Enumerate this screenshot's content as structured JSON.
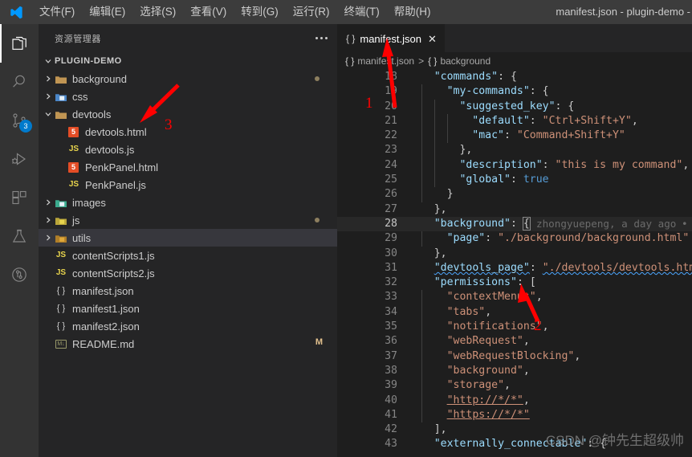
{
  "window": {
    "title": "manifest.json - plugin-demo -",
    "logo_icon": "vscode-logo-icon"
  },
  "menubar": {
    "items": [
      {
        "label": "文件(F)",
        "text": "文件",
        "key": "F"
      },
      {
        "label": "编辑(E)",
        "text": "编辑",
        "key": "E"
      },
      {
        "label": "选择(S)",
        "text": "选择",
        "key": "S"
      },
      {
        "label": "查看(V)",
        "text": "查看",
        "key": "V"
      },
      {
        "label": "转到(G)",
        "text": "转到",
        "key": "G"
      },
      {
        "label": "运行(R)",
        "text": "运行",
        "key": "R"
      },
      {
        "label": "终端(T)",
        "text": "终端",
        "key": "T"
      },
      {
        "label": "帮助(H)",
        "text": "帮助",
        "key": "H"
      }
    ]
  },
  "activitybar": {
    "items": [
      {
        "name": "explorer",
        "icon": "files-icon",
        "active": true,
        "badge": ""
      },
      {
        "name": "search",
        "icon": "search-icon",
        "active": false,
        "badge": ""
      },
      {
        "name": "source-control",
        "icon": "source-control-icon",
        "active": false,
        "badge": "3"
      },
      {
        "name": "run-and-debug",
        "icon": "run-debug-icon",
        "active": false,
        "badge": ""
      },
      {
        "name": "extensions",
        "icon": "extensions-icon",
        "active": false,
        "badge": ""
      },
      {
        "name": "testing",
        "icon": "beaker-icon",
        "active": false,
        "badge": ""
      },
      {
        "name": "git-graph",
        "icon": "git-circle-icon",
        "active": false,
        "badge": ""
      }
    ]
  },
  "sidebar": {
    "title": "资源管理器",
    "more_actions_icon": "more-actions-icon",
    "root": {
      "label": "PLUGIN-DEMO",
      "expanded": true
    },
    "tree": [
      {
        "label": "background",
        "type": "folder",
        "indent": 1,
        "expanded": false,
        "icon": "folder-icon",
        "modified_dot": true,
        "badge": ""
      },
      {
        "label": "css",
        "type": "folder",
        "indent": 1,
        "expanded": false,
        "icon": "folder-css-icon",
        "modified_dot": false,
        "badge": ""
      },
      {
        "label": "devtools",
        "type": "folder",
        "indent": 1,
        "expanded": true,
        "icon": "folder-open-icon",
        "modified_dot": false,
        "badge": ""
      },
      {
        "label": "devtools.html",
        "type": "file",
        "indent": 2,
        "icon": "html5-icon",
        "modified_dot": false,
        "badge": ""
      },
      {
        "label": "devtools.js",
        "type": "file",
        "indent": 2,
        "icon": "js-icon",
        "modified_dot": false,
        "badge": ""
      },
      {
        "label": "PenkPanel.html",
        "type": "file",
        "indent": 2,
        "icon": "html5-icon",
        "modified_dot": false,
        "badge": ""
      },
      {
        "label": "PenkPanel.js",
        "type": "file",
        "indent": 2,
        "icon": "js-icon",
        "modified_dot": false,
        "badge": ""
      },
      {
        "label": "images",
        "type": "folder",
        "indent": 1,
        "expanded": false,
        "icon": "folder-images-icon",
        "modified_dot": false,
        "badge": ""
      },
      {
        "label": "js",
        "type": "folder",
        "indent": 1,
        "expanded": false,
        "icon": "folder-js-icon",
        "modified_dot": true,
        "badge": ""
      },
      {
        "label": "utils",
        "type": "folder",
        "indent": 1,
        "expanded": false,
        "icon": "folder-utils-icon",
        "modified_dot": false,
        "badge": "",
        "selected": true
      },
      {
        "label": "contentScripts1.js",
        "type": "file",
        "indent": 1,
        "icon": "js-icon",
        "modified_dot": false,
        "badge": ""
      },
      {
        "label": "contentScripts2.js",
        "type": "file",
        "indent": 1,
        "icon": "js-icon",
        "modified_dot": false,
        "badge": ""
      },
      {
        "label": "manifest.json",
        "type": "file",
        "indent": 1,
        "icon": "json-icon",
        "modified_dot": false,
        "badge": ""
      },
      {
        "label": "manifest1.json",
        "type": "file",
        "indent": 1,
        "icon": "json-icon",
        "modified_dot": false,
        "badge": ""
      },
      {
        "label": "manifest2.json",
        "type": "file",
        "indent": 1,
        "icon": "json-icon",
        "modified_dot": false,
        "badge": ""
      },
      {
        "label": "README.md",
        "type": "file",
        "indent": 1,
        "icon": "markdown-icon",
        "modified_dot": false,
        "badge": "M"
      }
    ]
  },
  "editor": {
    "tab": {
      "label": "manifest.json",
      "icon": "json-icon",
      "close_icon": "close-icon"
    },
    "breadcrumb": [
      {
        "icon": "json-icon",
        "label": "manifest.json"
      },
      {
        "icon": "json-icon",
        "label": "background"
      }
    ],
    "breadcrumb_separator": ">",
    "blame": {
      "line": 28,
      "text": "zhongyuepeng, a day ago"
    },
    "current_line": 28,
    "first_visible_line": 18,
    "lines": [
      {
        "n": 18,
        "indent": 4,
        "tokens": [
          {
            "t": "\"commands\"",
            "c": "key"
          },
          {
            "t": ": {",
            "c": "punc"
          }
        ],
        "guides": 1
      },
      {
        "n": 19,
        "indent": 6,
        "tokens": [
          {
            "t": "\"my-commands\"",
            "c": "key"
          },
          {
            "t": ": {",
            "c": "punc"
          }
        ],
        "guides": 2
      },
      {
        "n": 20,
        "indent": 8,
        "tokens": [
          {
            "t": "\"suggested_key\"",
            "c": "key"
          },
          {
            "t": ": {",
            "c": "punc"
          }
        ],
        "guides": 3
      },
      {
        "n": 21,
        "indent": 10,
        "tokens": [
          {
            "t": "\"default\"",
            "c": "key"
          },
          {
            "t": ": ",
            "c": "punc"
          },
          {
            "t": "\"Ctrl+Shift+Y\"",
            "c": "str"
          },
          {
            "t": ",",
            "c": "punc"
          }
        ],
        "guides": 4
      },
      {
        "n": 22,
        "indent": 10,
        "tokens": [
          {
            "t": "\"mac\"",
            "c": "key"
          },
          {
            "t": ": ",
            "c": "punc"
          },
          {
            "t": "\"Command+Shift+Y\"",
            "c": "str"
          }
        ],
        "guides": 4
      },
      {
        "n": 23,
        "indent": 8,
        "tokens": [
          {
            "t": "},",
            "c": "punc"
          }
        ],
        "guides": 3
      },
      {
        "n": 24,
        "indent": 8,
        "tokens": [
          {
            "t": "\"description\"",
            "c": "key"
          },
          {
            "t": ": ",
            "c": "punc"
          },
          {
            "t": "\"this is my command\"",
            "c": "str"
          },
          {
            "t": ",",
            "c": "punc"
          }
        ],
        "guides": 3
      },
      {
        "n": 25,
        "indent": 8,
        "tokens": [
          {
            "t": "\"global\"",
            "c": "key"
          },
          {
            "t": ": ",
            "c": "punc"
          },
          {
            "t": "true",
            "c": "bool"
          }
        ],
        "guides": 3
      },
      {
        "n": 26,
        "indent": 6,
        "tokens": [
          {
            "t": "}",
            "c": "punc"
          }
        ],
        "guides": 2
      },
      {
        "n": 27,
        "indent": 4,
        "tokens": [
          {
            "t": "},",
            "c": "punc"
          }
        ],
        "guides": 1
      },
      {
        "n": 28,
        "indent": 4,
        "tokens": [
          {
            "t": "\"background\"",
            "c": "key"
          },
          {
            "t": ": ",
            "c": "punc"
          },
          {
            "t": "{",
            "c": "punc-match"
          }
        ],
        "guides": 1
      },
      {
        "n": 29,
        "indent": 6,
        "tokens": [
          {
            "t": "\"page\"",
            "c": "key"
          },
          {
            "t": ": ",
            "c": "punc"
          },
          {
            "t": "\"./background/background.html\"",
            "c": "str"
          }
        ],
        "guides": 2
      },
      {
        "n": 30,
        "indent": 4,
        "tokens": [
          {
            "t": "},",
            "c": "punc"
          }
        ],
        "guides": 1
      },
      {
        "n": 31,
        "indent": 4,
        "tokens": [
          {
            "t": "\"devtools_page\"",
            "c": "key-wavy"
          },
          {
            "t": ": ",
            "c": "punc"
          },
          {
            "t": "\"./devtools/devtools.html\"",
            "c": "str-wavy"
          },
          {
            "t": ",",
            "c": "punc"
          }
        ],
        "guides": 1
      },
      {
        "n": 32,
        "indent": 4,
        "tokens": [
          {
            "t": "\"permissions\"",
            "c": "key"
          },
          {
            "t": ": [",
            "c": "punc"
          }
        ],
        "guides": 1
      },
      {
        "n": 33,
        "indent": 6,
        "tokens": [
          {
            "t": "\"contextMenus\"",
            "c": "str"
          },
          {
            "t": ",",
            "c": "punc"
          }
        ],
        "guides": 2
      },
      {
        "n": 34,
        "indent": 6,
        "tokens": [
          {
            "t": "\"tabs\"",
            "c": "str"
          },
          {
            "t": ",",
            "c": "punc"
          }
        ],
        "guides": 2
      },
      {
        "n": 35,
        "indent": 6,
        "tokens": [
          {
            "t": "\"notifications\"",
            "c": "str"
          },
          {
            "t": ",",
            "c": "punc"
          }
        ],
        "guides": 2
      },
      {
        "n": 36,
        "indent": 6,
        "tokens": [
          {
            "t": "\"webRequest\"",
            "c": "str"
          },
          {
            "t": ",",
            "c": "punc"
          }
        ],
        "guides": 2
      },
      {
        "n": 37,
        "indent": 6,
        "tokens": [
          {
            "t": "\"webRequestBlocking\"",
            "c": "str"
          },
          {
            "t": ",",
            "c": "punc"
          }
        ],
        "guides": 2
      },
      {
        "n": 38,
        "indent": 6,
        "tokens": [
          {
            "t": "\"background\"",
            "c": "str"
          },
          {
            "t": ",",
            "c": "punc"
          }
        ],
        "guides": 2
      },
      {
        "n": 39,
        "indent": 6,
        "tokens": [
          {
            "t": "\"storage\"",
            "c": "str"
          },
          {
            "t": ",",
            "c": "punc"
          }
        ],
        "guides": 2
      },
      {
        "n": 40,
        "indent": 6,
        "tokens": [
          {
            "t": "\"http://*/*\"",
            "c": "str-link"
          },
          {
            "t": ",",
            "c": "punc"
          }
        ],
        "guides": 2
      },
      {
        "n": 41,
        "indent": 6,
        "tokens": [
          {
            "t": "\"https://*/*\"",
            "c": "str-link"
          }
        ],
        "guides": 2
      },
      {
        "n": 42,
        "indent": 4,
        "tokens": [
          {
            "t": "],",
            "c": "punc"
          }
        ],
        "guides": 1
      },
      {
        "n": 43,
        "indent": 4,
        "tokens": [
          {
            "t": "\"externally_connectable\"",
            "c": "key"
          },
          {
            "t": ": {",
            "c": "punc"
          }
        ],
        "guides": 1
      }
    ]
  },
  "annotations": [
    {
      "name": "arrow-3",
      "number": "3",
      "target": "devtools-folder"
    },
    {
      "name": "arrow-1",
      "number": "1",
      "target": "editor-tab"
    },
    {
      "name": "arrow-2",
      "number": "2",
      "target": "devtools-page-line"
    }
  ],
  "watermark": {
    "text": "CSDN @钟先生超级帅"
  },
  "colors": {
    "accent": "#007acc",
    "titlebar_bg": "#3c3c3c",
    "activitybar_bg": "#333333",
    "sidebar_bg": "#252526",
    "editor_bg": "#1e1e1e",
    "selection_bg": "#37373d",
    "annotation_red": "#ff0000",
    "modified_dot": "#8d7f5f",
    "json_key": "#9cdcfe",
    "json_string": "#ce9178",
    "json_bool": "#569cd6"
  }
}
